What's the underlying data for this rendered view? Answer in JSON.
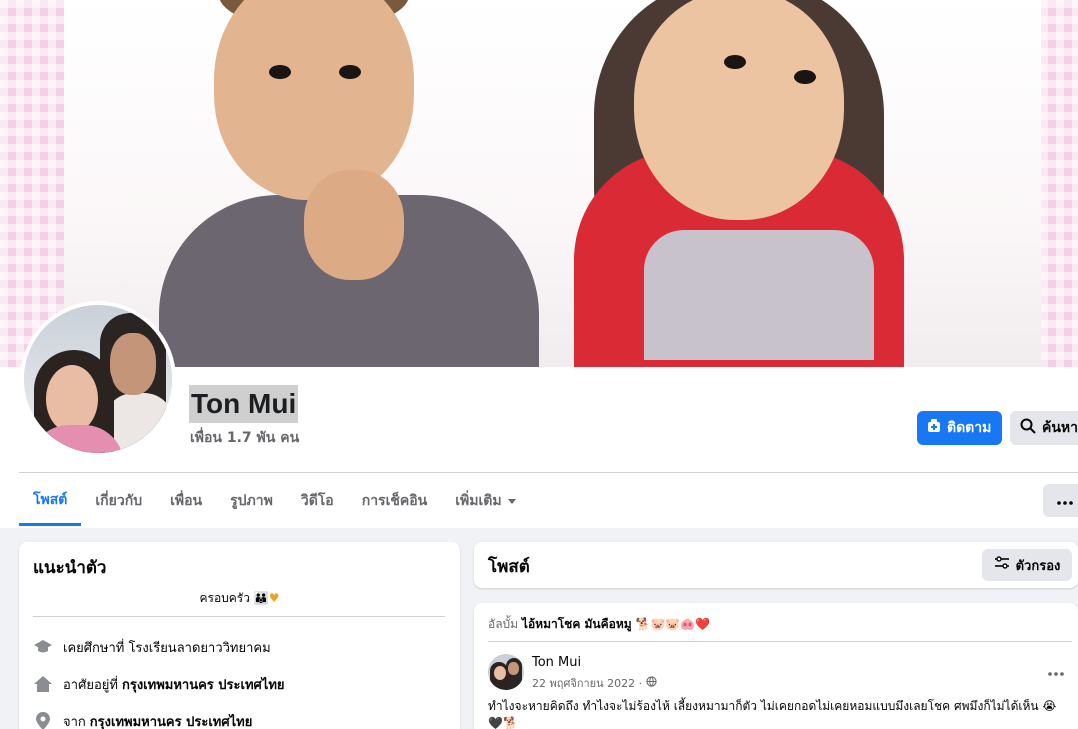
{
  "profile": {
    "name": "Ton Mui",
    "friends": "เพื่อน 1.7 พัน คน"
  },
  "actions": {
    "follow_label": "ติดตาม",
    "search_label": "ค้นหา",
    "follow_icon": "follow-icon",
    "search_icon": "search-icon",
    "more_icon": "more-dots-icon"
  },
  "tabs": [
    {
      "label": "โพสต์",
      "active": true
    },
    {
      "label": "เกี่ยวกับ"
    },
    {
      "label": "เพื่อน"
    },
    {
      "label": "รูปภาพ"
    },
    {
      "label": "วิดีโอ"
    },
    {
      "label": "การเช็คอิน"
    },
    {
      "label": "เพิ่มเติม"
    }
  ],
  "intro": {
    "title": "แนะนำตัว",
    "bio": "ครอบครัว",
    "bio_emoji": "👪♥",
    "education_label": "เคยศึกษาที่ โรงเรียนลาดยาววิทยาคม",
    "lives_prefix": "อาศัยอยู่ที่",
    "lives_value": "กรุงเทพมหานคร ประเทศไทย",
    "from_prefix": "จาก",
    "from_value": "กรุงเทพมหานคร ประเทศไทย"
  },
  "posts_header": {
    "title": "โพสต์",
    "filter_label": "ตัวกรอง"
  },
  "post": {
    "album_prefix": "อัลบั้ม",
    "album_name": "ไอ้หมาโชค มันคือหมู",
    "album_emoji": "🐕🐷🐷🐽❤️",
    "author": "Ton Mui",
    "date": "22 พฤศจิกายน 2022 ·",
    "text": "ทำไงจะหายคิดถึง ทำไงจะไม่ร้องไห้ เลี้ยงหมามาก็ตัว ไม่เคยกอดไม่เคยหอมแบบมึงเลยโชค ศพมึงก็ไม่ได้เห็น 😭🖤🐕"
  },
  "colors": {
    "accent": "#1877f2",
    "background": "#f0f2f5",
    "secondary_text": "#65676b"
  }
}
